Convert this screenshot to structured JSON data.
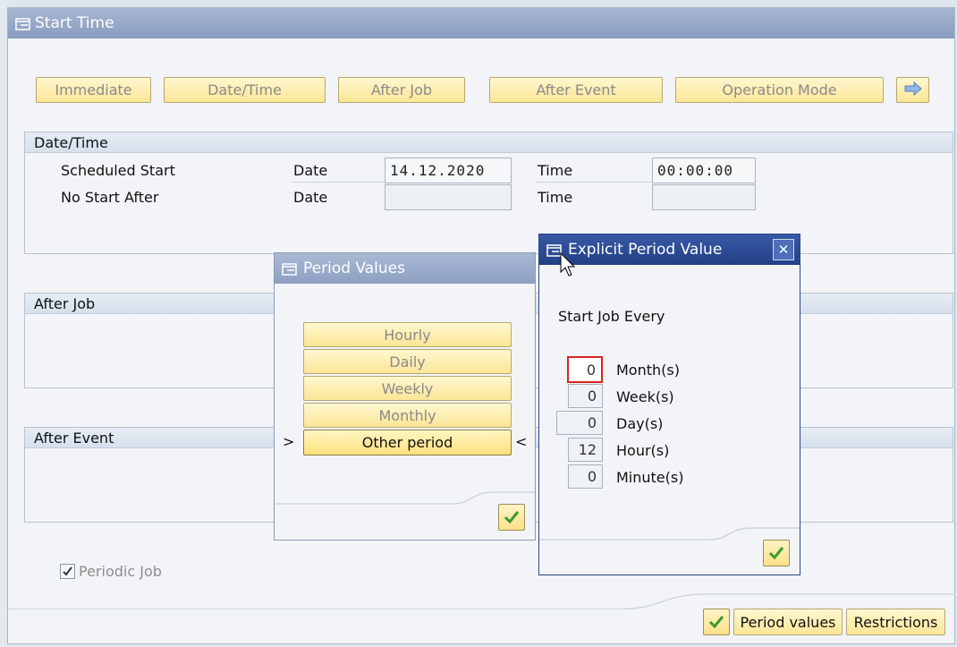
{
  "window": {
    "title": "Start Time"
  },
  "toolbar": {
    "immediate": "Immediate",
    "datetime": "Date/Time",
    "after_job": "After Job",
    "after_event": "After Event",
    "operation_mode": "Operation Mode"
  },
  "datetime_group": {
    "title": "Date/Time",
    "scheduled_start": "Scheduled Start",
    "no_start_after": "No Start After",
    "date_label": "Date",
    "time_label": "Time",
    "scheduled_date": "14.12.2020",
    "scheduled_time": "00:00:00",
    "nostart_date": "",
    "nostart_time": ""
  },
  "after_job_group": {
    "title": "After Job"
  },
  "after_event_group": {
    "title": "After Event"
  },
  "periodic": {
    "label": "Periodic Job",
    "checked": true
  },
  "footer": {
    "period_values": "Period values",
    "restrictions": "Restrictions"
  },
  "period_values_dialog": {
    "title": "Period Values",
    "options": [
      "Hourly",
      "Daily",
      "Weekly",
      "Monthly",
      "Other period"
    ],
    "marker_left": ">",
    "marker_right": "<"
  },
  "explicit_dialog": {
    "title": "Explicit Period Value",
    "close": "✕",
    "heading": "Start Job Every",
    "fields": [
      {
        "label": "Month(s)",
        "value": "0"
      },
      {
        "label": "Week(s)",
        "value": "0"
      },
      {
        "label": "Day(s)",
        "value": "0"
      },
      {
        "label": "Hour(s)",
        "value": "12"
      },
      {
        "label": "Minute(s)",
        "value": "0"
      }
    ]
  },
  "icons": {
    "window": "window-edit-icon",
    "next": "arrow-right-icon",
    "ok": "checkmark-icon"
  },
  "colors": {
    "button_yellow": "#fbe596",
    "title_dark": "#233f86",
    "title_light": "#8da0c2",
    "focus_red": "#d92222"
  }
}
